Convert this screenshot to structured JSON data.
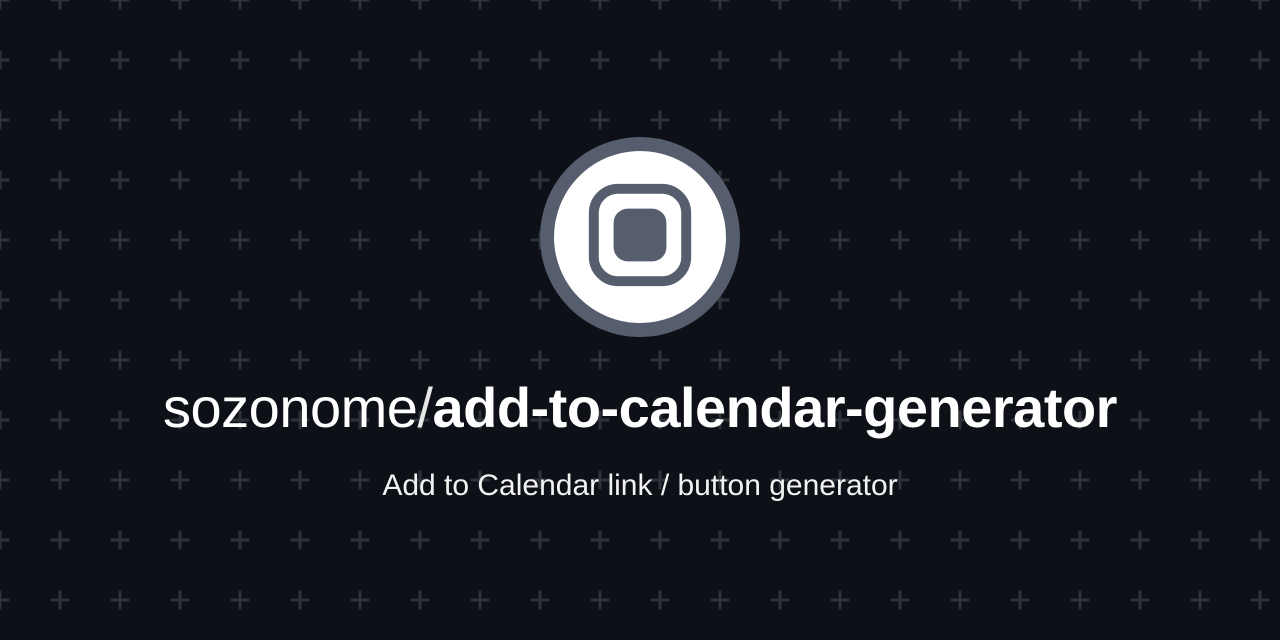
{
  "owner": "sozonome",
  "separator": "/",
  "repo": "add-to-calendar-generator",
  "description": "Add to Calendar link / button generator",
  "colors": {
    "background": "#0d1117",
    "pattern": "#30363d",
    "avatar_border": "#565d6d",
    "avatar_bg": "#ffffff",
    "avatar_icon": "#565d6d",
    "text": "#ffffff"
  },
  "icon": "rounded-square-icon"
}
